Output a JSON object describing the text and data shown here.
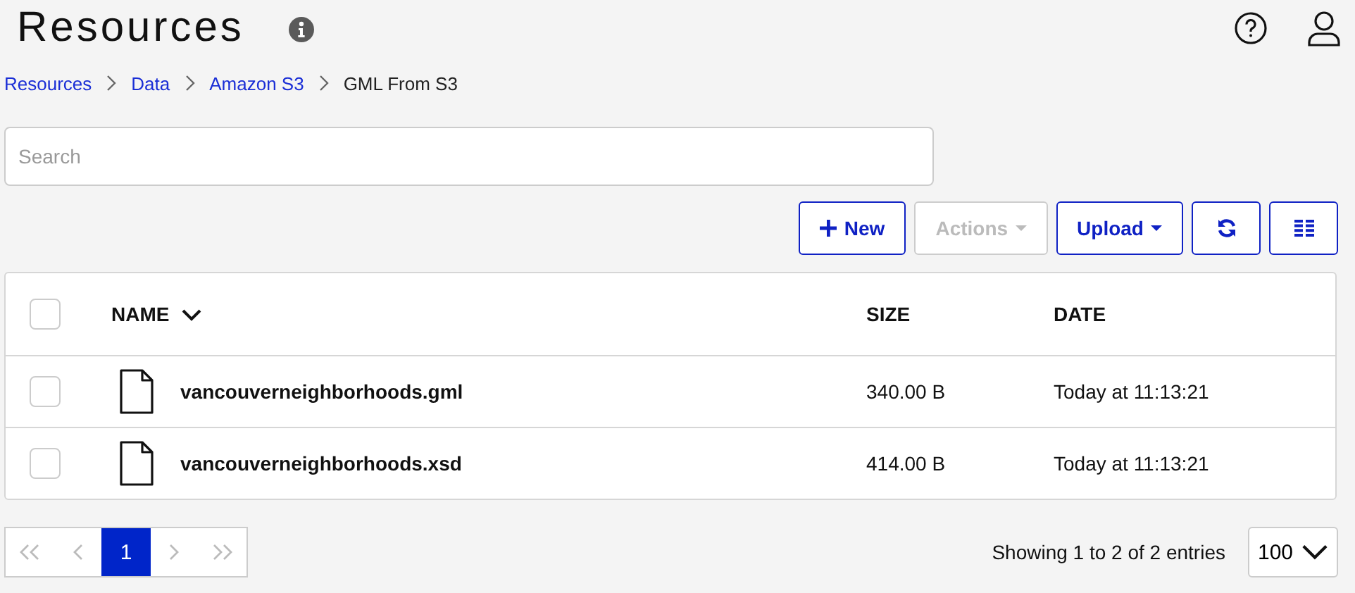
{
  "header": {
    "title": "Resources"
  },
  "breadcrumb": [
    {
      "label": "Resources",
      "current": false
    },
    {
      "label": "Data",
      "current": false
    },
    {
      "label": "Amazon S3",
      "current": false
    },
    {
      "label": "GML From S3",
      "current": true
    }
  ],
  "search": {
    "placeholder": "Search"
  },
  "toolbar": [
    {
      "kind": "new",
      "label": "New",
      "disabled": false
    },
    {
      "kind": "dropdown",
      "label": "Actions",
      "disabled": true
    },
    {
      "kind": "dropdown",
      "label": "Upload",
      "disabled": false
    },
    {
      "kind": "refresh",
      "disabled": false
    },
    {
      "kind": "columns",
      "disabled": false
    }
  ],
  "table": {
    "select_all": {
      "checked": false
    },
    "columns": [
      {
        "label": "NAME",
        "sorted": true
      },
      {
        "label": "SIZE",
        "sorted": false
      },
      {
        "label": "DATE",
        "sorted": false
      }
    ],
    "rows": [
      {
        "checked": false,
        "name": "vancouverneighborhoods.gml",
        "size": "340.00 B",
        "date": "Today at 11:13:21"
      },
      {
        "checked": false,
        "name": "vancouverneighborhoods.xsd",
        "size": "414.00 B",
        "date": "Today at 11:13:21"
      }
    ]
  },
  "pagination": {
    "pages": [
      {
        "label": "1",
        "selected": true
      }
    ],
    "summary": "Showing 1 to 2 of 2 entries",
    "page_size": "100"
  }
}
